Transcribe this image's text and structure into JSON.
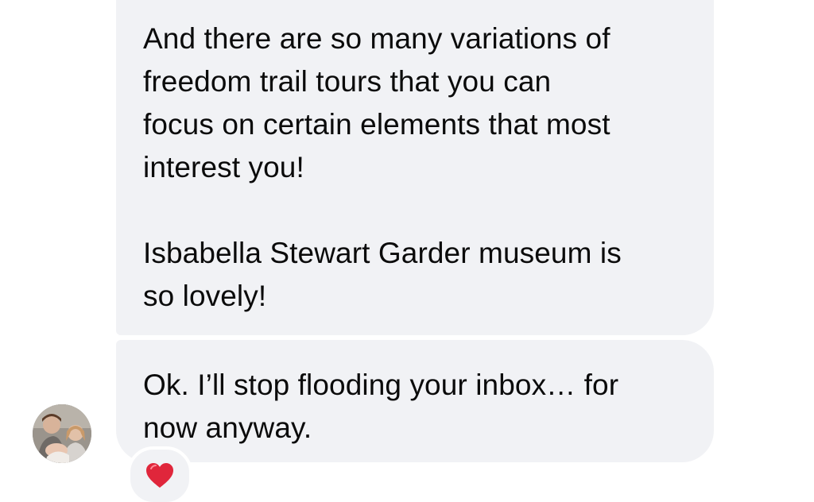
{
  "messages": [
    {
      "paragraphs": [
        "And there are so many variations of\nfreedom trail tours that you can\nfocus on certain elements that most\ninterest you!",
        "Isbabella Stewart Garder museum is\nso lovely!"
      ]
    },
    {
      "paragraphs": [
        "Ok. I’ll stop flooding your inbox… for\nnow anyway."
      ]
    }
  ],
  "sender": {
    "avatar": "profile-photo-avatar"
  },
  "reaction": {
    "icon": "red-heart-icon",
    "color": "#e0263b"
  },
  "colors": {
    "bubble": "#f1f2f5",
    "text": "#0b0b0b",
    "background": "#ffffff"
  }
}
